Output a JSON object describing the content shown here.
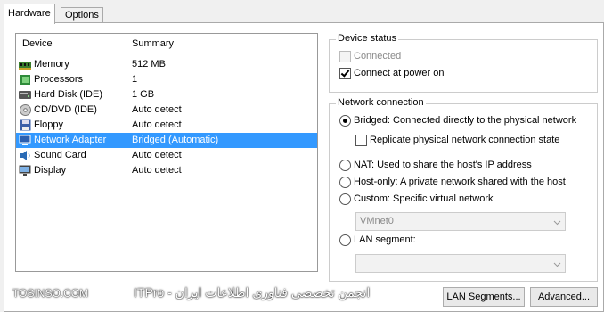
{
  "tabs": [
    {
      "label": "Hardware"
    },
    {
      "label": "Options"
    }
  ],
  "device_list": {
    "columns": [
      "Device",
      "Summary"
    ],
    "items": [
      {
        "name": "Memory",
        "summary": "512 MB",
        "icon": "memory-icon"
      },
      {
        "name": "Processors",
        "summary": "1",
        "icon": "processor-icon"
      },
      {
        "name": "Hard Disk (IDE)",
        "summary": "1 GB",
        "icon": "hard-disk-icon"
      },
      {
        "name": "CD/DVD (IDE)",
        "summary": "Auto detect",
        "icon": "cd-dvd-icon"
      },
      {
        "name": "Floppy",
        "summary": "Auto detect",
        "icon": "floppy-icon"
      },
      {
        "name": "Network Adapter",
        "summary": "Bridged (Automatic)",
        "icon": "network-adapter-icon",
        "selected": true
      },
      {
        "name": "Sound Card",
        "summary": "Auto detect",
        "icon": "sound-card-icon"
      },
      {
        "name": "Display",
        "summary": "Auto detect",
        "icon": "display-icon"
      }
    ]
  },
  "device_status": {
    "title": "Device status",
    "connected": {
      "label": "Connected",
      "checked": false,
      "disabled": true
    },
    "connect_at_power_on": {
      "label": "Connect at power on",
      "checked": true
    }
  },
  "network_connection": {
    "title": "Network connection",
    "bridged": "Bridged: Connected directly to the physical network",
    "replicate": "Replicate physical network connection state",
    "nat": "NAT: Used to share the host's IP address",
    "host_only": "Host-only: A private network shared with the host",
    "custom": "Custom: Specific virtual network",
    "vmnet_value": "VMnet0",
    "lan_segment": "LAN segment:",
    "lan_segment_value": ""
  },
  "buttons": {
    "lan_segments": "LAN Segments...",
    "advanced": "Advanced..."
  },
  "watermark": {
    "left": "TOSINSO.COM",
    "right": "ITPro - انجمن تخصصی فناوری اطلاعات ایران"
  }
}
